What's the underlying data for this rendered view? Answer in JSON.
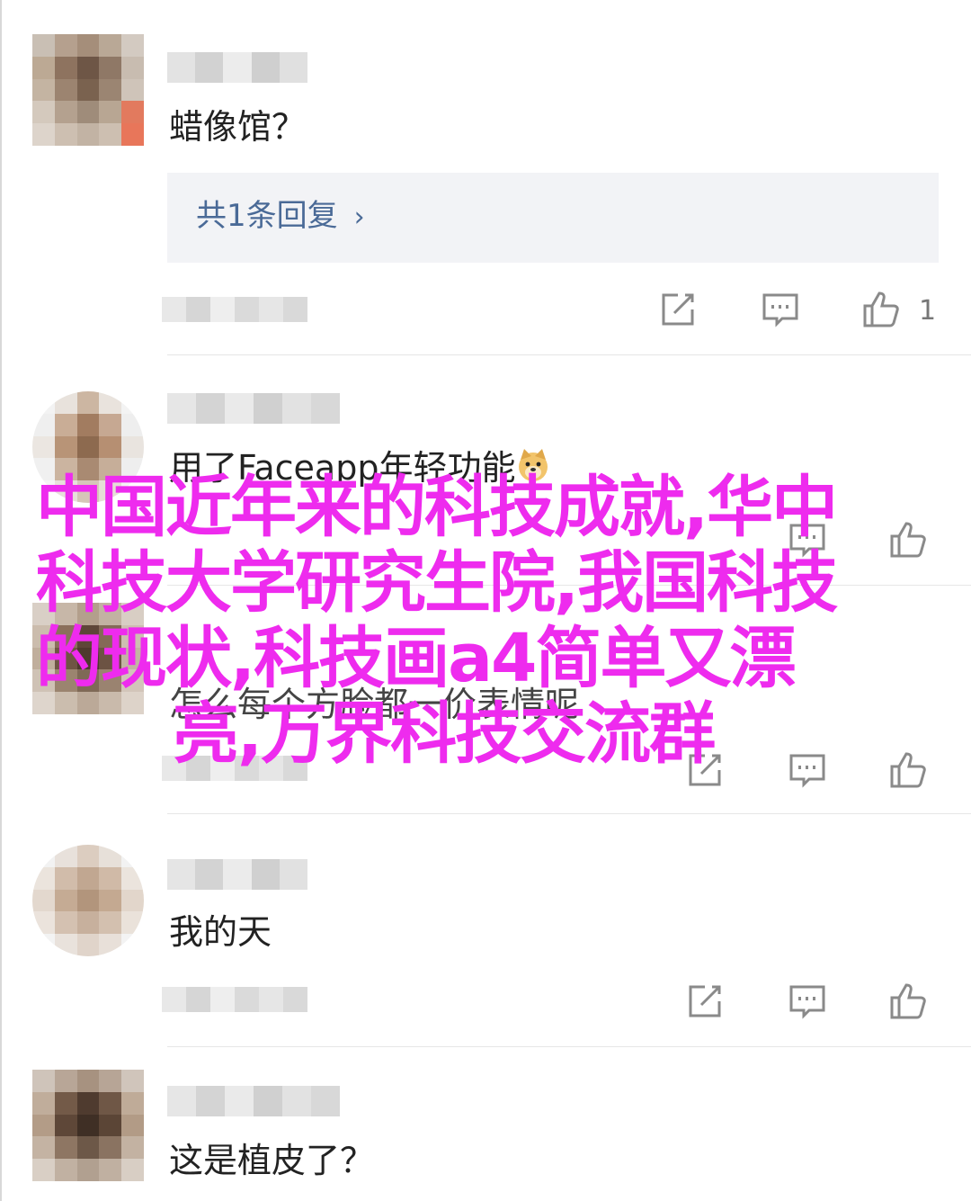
{
  "comments": [
    {
      "text": "蜡像馆？",
      "replies_label": "共1条回复",
      "like_count": "1"
    },
    {
      "text_before_emoji": "用了Faceapp年轻功能",
      "emoji": "doge-emoji"
    },
    {
      "text_partial": "怎么每个方脸都一价表情呢"
    },
    {
      "text": "我的天"
    },
    {
      "text": "这是植皮了？"
    }
  ],
  "overlay": {
    "line1": "中国近年来的科技成就,华中",
    "line2": "科技大学研究生院,我国科技",
    "line3": "的现状,科技画a4简单又漂",
    "line4": "亮,万界科技交流群",
    "color": "#ee2bee"
  },
  "colors": {
    "reply_link": "#4a6a97",
    "reply_bg": "#f2f3f6",
    "divider": "#e6e6e6"
  },
  "icons": [
    "edit-icon",
    "comment-icon",
    "thumbs-up-icon",
    "reply-chevron-icon"
  ]
}
